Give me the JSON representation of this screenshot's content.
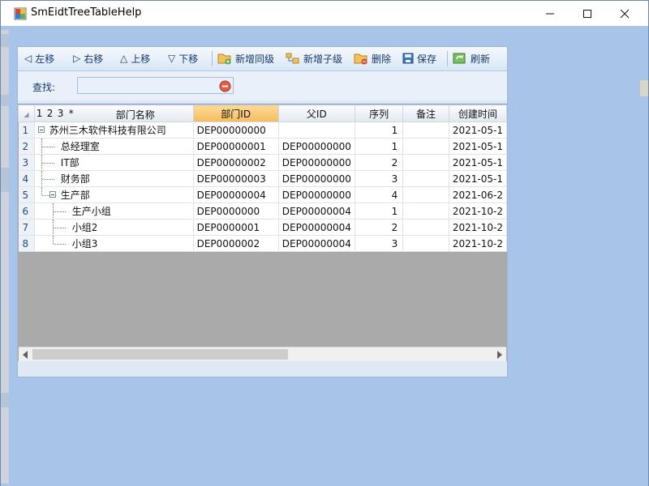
{
  "window": {
    "title": "SmEidtTreeTableHelp",
    "app_icon": "windows-form-icon",
    "controls": {
      "minimize_icon": "minimize-icon",
      "maximize_icon": "maximize-icon",
      "close_icon": "close-icon"
    }
  },
  "toolbar": {
    "move_left": "左移",
    "move_right": "右移",
    "move_up": "上移",
    "move_down": "下移",
    "add_sibling": "新增同级",
    "add_child": "新增子级",
    "delete": "删除",
    "save": "保存",
    "refresh": "刷新"
  },
  "search": {
    "label": "查找:",
    "value": "",
    "placeholder": ""
  },
  "grid": {
    "header_controls": [
      "1",
      "2",
      "3",
      "*"
    ],
    "columns": [
      "部门名称",
      "部门ID",
      "父ID",
      "序列",
      "备注",
      "创建时间"
    ],
    "active_column": "部门ID",
    "rows": [
      {
        "index": "1",
        "name": "苏州三木软件科技有限公司",
        "dept_id": "DEP00000000",
        "parent_id": "",
        "order": "1",
        "remark": "",
        "created": "2021-05-1"
      },
      {
        "index": "2",
        "name": "总经理室",
        "dept_id": "DEP00000001",
        "parent_id": "DEP00000000",
        "order": "1",
        "remark": "",
        "created": "2021-05-1"
      },
      {
        "index": "3",
        "name": "IT部",
        "dept_id": "DEP00000002",
        "parent_id": "DEP00000000",
        "order": "2",
        "remark": "",
        "created": "2021-05-1"
      },
      {
        "index": "4",
        "name": "财务部",
        "dept_id": "DEP00000003",
        "parent_id": "DEP00000000",
        "order": "3",
        "remark": "",
        "created": "2021-05-1"
      },
      {
        "index": "5",
        "name": "生产部",
        "dept_id": "DEP00000004",
        "parent_id": "DEP00000000",
        "order": "4",
        "remark": "",
        "created": "2021-06-2"
      },
      {
        "index": "6",
        "name": "生产小组",
        "dept_id": "DEP0000000",
        "parent_id": "DEP00000004",
        "order": "1",
        "remark": "",
        "created": "2021-10-2"
      },
      {
        "index": "7",
        "name": "小组2",
        "dept_id": "DEP0000001",
        "parent_id": "DEP00000004",
        "order": "2",
        "remark": "",
        "created": "2021-10-2"
      },
      {
        "index": "8",
        "name": "小组3",
        "dept_id": "DEP0000002",
        "parent_id": "DEP00000004",
        "order": "3",
        "remark": "",
        "created": "2021-10-2"
      }
    ]
  },
  "colors": {
    "window_background": "#a8c4e8",
    "panel_background": "#dfe9f6",
    "active_header": "#f5bd5b",
    "grid_empty_area": "#aaaaaa"
  }
}
